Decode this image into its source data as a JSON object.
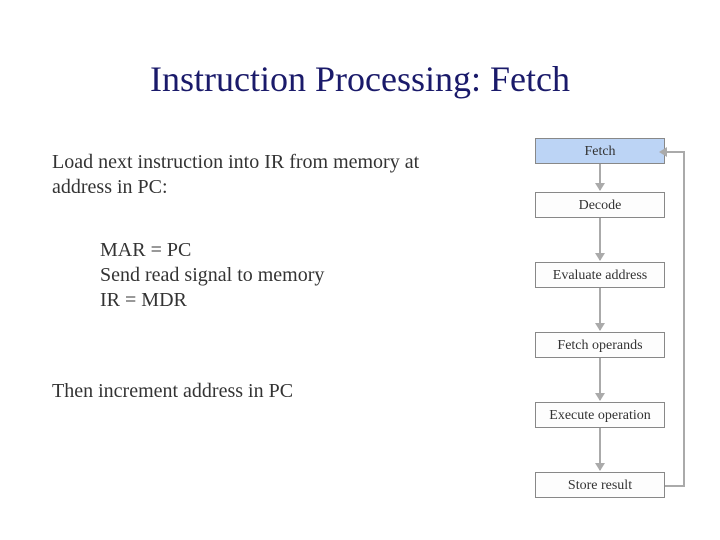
{
  "title": "Instruction Processing: Fetch",
  "description": "Load next instruction into IR from memory at address in PC:",
  "steps": {
    "line1": "MAR = PC",
    "line2": "Send read signal to memory",
    "line3": "IR = MDR"
  },
  "then": "Then increment address in PC",
  "flow": {
    "fetch": "Fetch",
    "decode": "Decode",
    "evaluate": "Evaluate address",
    "operands": "Fetch operands",
    "execute": "Execute operation",
    "store": "Store result"
  }
}
